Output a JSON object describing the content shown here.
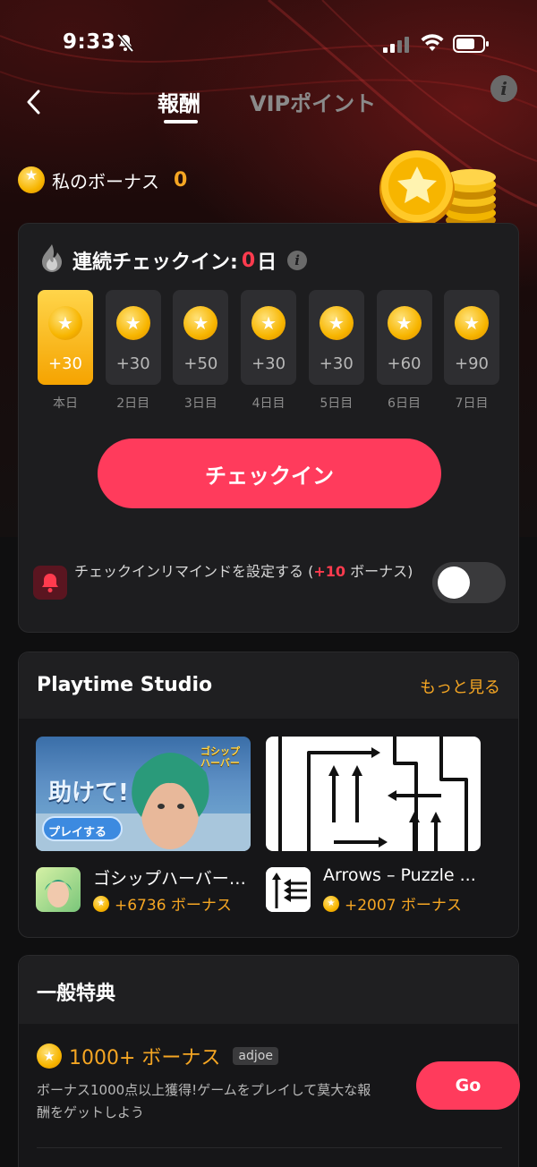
{
  "status_bar": {
    "time": "9:33"
  },
  "header": {
    "tabs": [
      {
        "label": "報酬"
      },
      {
        "label": "VIPポイント"
      }
    ]
  },
  "bonus": {
    "label": "私のボーナス",
    "value": "0"
  },
  "checkin": {
    "title": "連続チェックイン:",
    "days_count": "0",
    "days_unit": "日",
    "days": [
      {
        "points": "+30",
        "label": "本日"
      },
      {
        "points": "+30",
        "label": "2日目"
      },
      {
        "points": "+50",
        "label": "3日目"
      },
      {
        "points": "+30",
        "label": "4日目"
      },
      {
        "points": "+30",
        "label": "5日目"
      },
      {
        "points": "+60",
        "label": "6日目"
      },
      {
        "points": "+90",
        "label": "7日目"
      }
    ],
    "button_label": "チェックイン",
    "reminder_prefix": "チェックインリマインドを設定する (",
    "reminder_bonus": "+10",
    "reminder_suffix": " ボーナス)",
    "reminder_enabled": false
  },
  "playtime": {
    "title": "Playtime Studio",
    "more_label": "もっと見る",
    "games": [
      {
        "name": "ゴシップハーバー: ...",
        "bonus": "+6736 ボーナス",
        "thumb_text": "助けて!",
        "thumb_button": "プレイする",
        "logo_text": "ゴシップハーバー"
      },
      {
        "name": "Arrows – Puzzle ...",
        "bonus": "+2007 ボーナス"
      }
    ]
  },
  "general": {
    "title": "一般特典",
    "offer": {
      "title": "1000+ ボーナス",
      "tag": "adjoe",
      "description": "ボーナス1000点以上獲得!ゲームをプレイして莫大な報酬をゲットしよう",
      "button_label": "Go"
    }
  },
  "colors": {
    "accent_red": "#ff3b5c",
    "accent_gold": "#f5a623",
    "card_bg": "#1d1d1f"
  }
}
